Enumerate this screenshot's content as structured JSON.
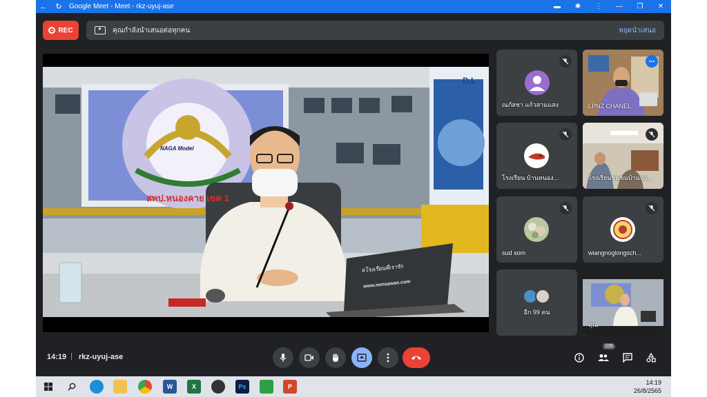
{
  "window": {
    "title": "Google Meet - Meet - rkz-uyuj-ase"
  },
  "recording": {
    "label": "REC"
  },
  "presenting_bar": {
    "message": "คุณกำลังนำเสนอต่อทุกคน",
    "stop_label": "หยุดนำเสนอ"
  },
  "presentation": {
    "banner_text": "สพป.หนองคาย เขต 1",
    "logo_text": "NAGA Model",
    "laptop_caption_1": "#โรงเรียนที่เรารัก",
    "laptop_caption_2": "www.nonsawan.com",
    "corner_logo": "DL"
  },
  "participants": [
    {
      "name": "ณภัสชา แก้วสามแสง",
      "type": "avatar",
      "muted": true
    },
    {
      "name": "LPNZ CHANEL",
      "type": "video",
      "muted": false,
      "active": true
    },
    {
      "name": "โรงเรียน บ้านหนอง...",
      "type": "logo",
      "muted": true
    },
    {
      "name": "โรงเรียนชุมชนบ้านหล...",
      "type": "video",
      "muted": true
    },
    {
      "name": "sud som",
      "type": "avatar",
      "muted": true
    },
    {
      "name": "wiangnoglongsch...",
      "type": "logo",
      "muted": true
    },
    {
      "name": "อีก 99 คน",
      "type": "group",
      "muted": false
    },
    {
      "name": "คุณ",
      "type": "self",
      "muted": false
    }
  ],
  "bottom_bar": {
    "time": "14:19",
    "separator": "|",
    "meeting_code": "rkz-uyuj-ase",
    "participant_count": "106"
  },
  "taskbar": {
    "clock_time": "14:19",
    "clock_date": "26/8/2565"
  },
  "colors": {
    "meet_bg": "#202124",
    "tile_bg": "#3c4043",
    "accent": "#8ab4f8",
    "danger": "#ea4335",
    "titlebar": "#1a73e8"
  }
}
